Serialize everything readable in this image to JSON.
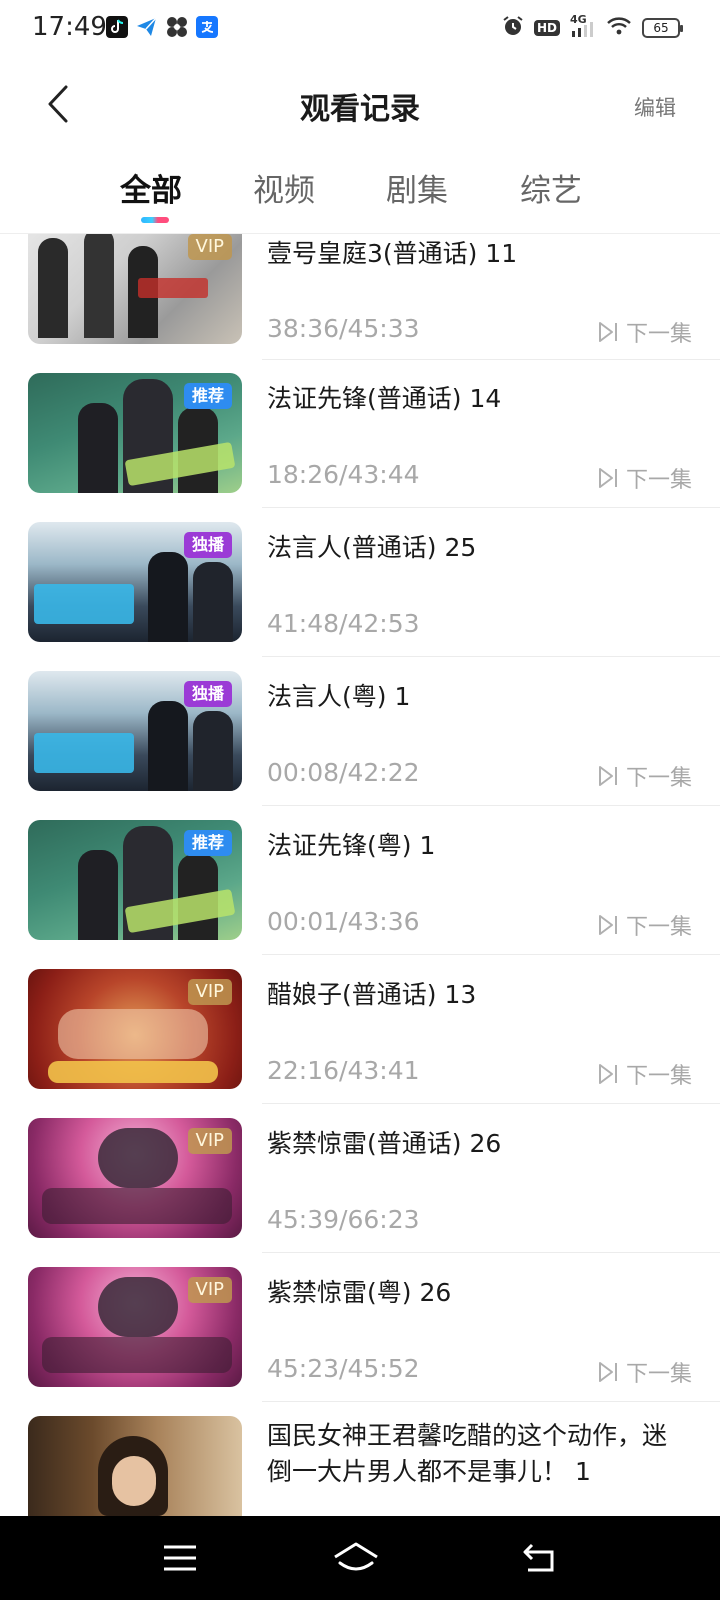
{
  "status": {
    "time": "17:49",
    "battery": "65",
    "network": "4G",
    "hd": "HD"
  },
  "header": {
    "title": "观看记录",
    "edit_label": "编辑"
  },
  "tabs": [
    {
      "label": "全部"
    },
    {
      "label": "视频"
    },
    {
      "label": "剧集"
    },
    {
      "label": "综艺"
    }
  ],
  "next_label": "下一集",
  "items": [
    {
      "title": "壹号皇庭3(普通话) 11",
      "progress": "38:36/45:33",
      "badge": "VIP",
      "next": true
    },
    {
      "title": "法证先锋(普通话) 14",
      "progress": "18:26/43:44",
      "badge": "推荐",
      "next": true
    },
    {
      "title": "法言人(普通话) 25",
      "progress": "41:48/42:53",
      "badge": "独播",
      "next": false
    },
    {
      "title": "法言人(粤) 1",
      "progress": "00:08/42:22",
      "badge": "独播",
      "next": true
    },
    {
      "title": "法证先锋(粤) 1",
      "progress": "00:01/43:36",
      "badge": "推荐",
      "next": true
    },
    {
      "title": "醋娘子(普通话) 13",
      "progress": "22:16/43:41",
      "badge": "VIP",
      "next": true
    },
    {
      "title": "紫禁惊雷(普通话) 26",
      "progress": "45:39/66:23",
      "badge": "VIP",
      "next": false
    },
    {
      "title": "紫禁惊雷(粤) 26",
      "progress": "45:23/45:52",
      "badge": "VIP",
      "next": true
    },
    {
      "title": "国民女神王君馨吃醋的这个动作，迷倒一大片男人都不是事儿！ 1",
      "progress": "",
      "badge": "",
      "next": false
    }
  ],
  "colors": {
    "accent_blue": "#2fb5ff",
    "accent_pink": "#ff4d7d",
    "muted_text": "#a8a8a8"
  }
}
